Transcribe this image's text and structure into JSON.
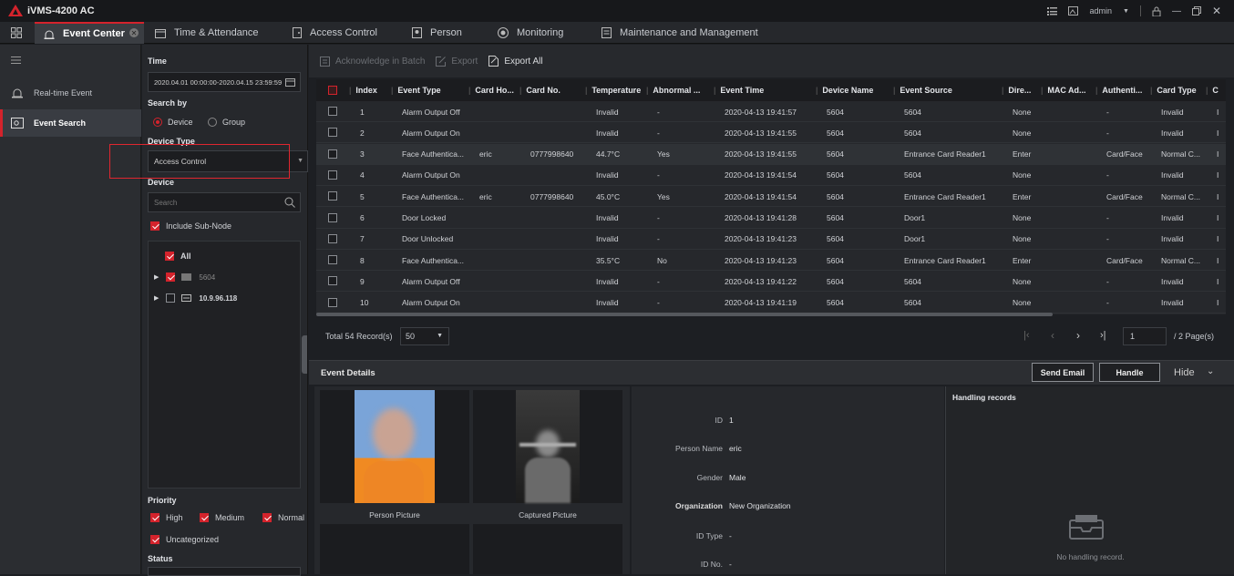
{
  "app": {
    "title": "iVMS-4200 AC",
    "user": "admin"
  },
  "tabs": [
    {
      "label": "Event Center"
    },
    {
      "label": "Time & Attendance"
    },
    {
      "label": "Access Control"
    },
    {
      "label": "Person"
    },
    {
      "label": "Monitoring"
    },
    {
      "label": "Maintenance and Management"
    }
  ],
  "nav": {
    "realtime": "Real-time Event",
    "search": "Event Search"
  },
  "search": {
    "time_label": "Time",
    "time_value": "2020.04.01 00:00:00-2020.04.15 23:59:59",
    "search_by_label": "Search by",
    "by_device": "Device",
    "by_group": "Group",
    "device_type_label": "Device Type",
    "device_type_value": "Access Control",
    "device_label": "Device",
    "device_search_placeholder": "Search",
    "include_sub_node": "Include Sub-Node",
    "tree": {
      "all": "All",
      "node1": "5604",
      "node2": "10.9.96.118"
    },
    "priority_label": "Priority",
    "priority": {
      "high": "High",
      "medium": "Medium",
      "normal": "Normal",
      "uncategorized": "Uncategorized"
    },
    "status_label": "Status"
  },
  "toolbar": {
    "ack": "Acknowledge in Batch",
    "export": "Export",
    "export_all": "Export All"
  },
  "table": {
    "columns": [
      "Index",
      "Event Type",
      "Card Ho...",
      "Card No.",
      "Temperature",
      "Abnormal ...",
      "Event Time",
      "Device Name",
      "Event Source",
      "Dire...",
      "MAC Ad...",
      "Authenti...",
      "Card Type",
      "C"
    ],
    "rows": [
      [
        "1",
        "Alarm Output Off",
        "",
        "",
        "Invalid",
        "-",
        "2020-04-13 19:41:57",
        "5604",
        "5604",
        "None",
        "",
        "-",
        "Invalid",
        "I"
      ],
      [
        "2",
        "Alarm Output On",
        "",
        "",
        "Invalid",
        "-",
        "2020-04-13 19:41:55",
        "5604",
        "5604",
        "None",
        "",
        "-",
        "Invalid",
        "I"
      ],
      [
        "3",
        "Face Authentica...",
        "eric",
        "0777998640",
        "44.7°C",
        "Yes",
        "2020-04-13 19:41:55",
        "5604",
        "Entrance Card Reader1",
        "Enter",
        "",
        "Card/Face",
        "Normal C...",
        "I"
      ],
      [
        "4",
        "Alarm Output On",
        "",
        "",
        "Invalid",
        "-",
        "2020-04-13 19:41:54",
        "5604",
        "5604",
        "None",
        "",
        "-",
        "Invalid",
        "I"
      ],
      [
        "5",
        "Face Authentica...",
        "eric",
        "0777998640",
        "45.0°C",
        "Yes",
        "2020-04-13 19:41:54",
        "5604",
        "Entrance Card Reader1",
        "Enter",
        "",
        "Card/Face",
        "Normal C...",
        "I"
      ],
      [
        "6",
        "Door Locked",
        "",
        "",
        "Invalid",
        "-",
        "2020-04-13 19:41:28",
        "5604",
        "Door1",
        "None",
        "",
        "-",
        "Invalid",
        "I"
      ],
      [
        "7",
        "Door Unlocked",
        "",
        "",
        "Invalid",
        "-",
        "2020-04-13 19:41:23",
        "5604",
        "Door1",
        "None",
        "",
        "-",
        "Invalid",
        "I"
      ],
      [
        "8",
        "Face Authentica...",
        "",
        "",
        "35.5°C",
        "No",
        "2020-04-13 19:41:23",
        "5604",
        "Entrance Card Reader1",
        "Enter",
        "",
        "Card/Face",
        "Normal C...",
        "I"
      ],
      [
        "9",
        "Alarm Output Off",
        "",
        "",
        "Invalid",
        "-",
        "2020-04-13 19:41:22",
        "5604",
        "5604",
        "None",
        "",
        "-",
        "Invalid",
        "I"
      ],
      [
        "10",
        "Alarm Output On",
        "",
        "",
        "Invalid",
        "-",
        "2020-04-13 19:41:19",
        "5604",
        "5604",
        "None",
        "",
        "-",
        "Invalid",
        "I"
      ]
    ]
  },
  "pager": {
    "total": "Total 54 Record(s)",
    "page_size": "50",
    "current_page": "1",
    "pages": "/ 2 Page(s)"
  },
  "details": {
    "title": "Event Details",
    "send_email": "Send Email",
    "handle": "Handle",
    "hide": "Hide",
    "person_picture": "Person Picture",
    "captured_picture": "Captured Picture",
    "fields": [
      {
        "k": "ID",
        "v": "1"
      },
      {
        "k": "Person Name",
        "v": "eric"
      },
      {
        "k": "Gender",
        "v": "Male"
      },
      {
        "k": "Organization",
        "v": "New Organization"
      },
      {
        "k": "ID Type",
        "v": "-"
      },
      {
        "k": "ID No.",
        "v": "-"
      }
    ],
    "handling_title": "Handling records",
    "no_handling": "No handling record."
  },
  "colors": {
    "accent": "#d4232c",
    "bg": "#1d1f23"
  }
}
